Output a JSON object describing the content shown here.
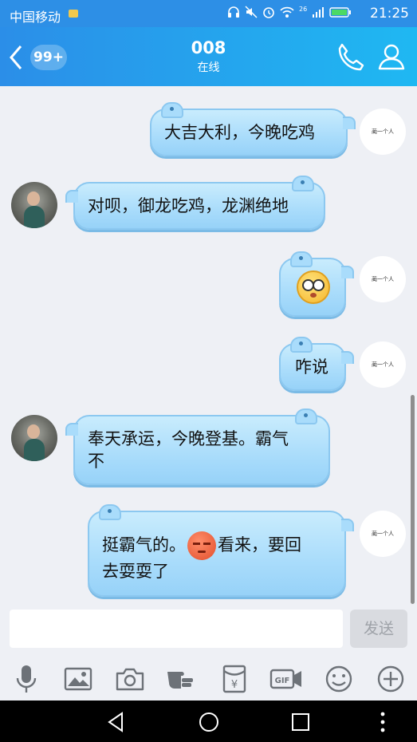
{
  "status_bar": {
    "carrier": "中国移动",
    "time": "21:25",
    "signal_label": "26"
  },
  "header": {
    "unread_count": "99+",
    "title": "008",
    "status": "在线"
  },
  "messages": [
    {
      "sender": "self",
      "text": "大吉大利，今晚吃鸡"
    },
    {
      "sender": "other",
      "text": "对呗，御龙吃鸡，龙渊绝地"
    },
    {
      "sender": "self",
      "emoji": "shocked-face-emoji"
    },
    {
      "sender": "self",
      "text": "咋说"
    },
    {
      "sender": "other",
      "line1": "奉天承运，今晚登基。霸气",
      "line2": "不"
    },
    {
      "sender": "self",
      "part1": "挺霸气的。",
      "part2": "看来，要回",
      "line2": "去耍耍了",
      "emoji": "angry-face-emoji"
    }
  ],
  "self_avatar_signature": "蔺一个人",
  "composer": {
    "input_value": "",
    "send_label": "发送"
  },
  "toolbar": {
    "items": [
      "microphone-icon",
      "image-icon",
      "camera-icon",
      "poke-hand-icon",
      "red-packet-icon",
      "gif-icon",
      "emoji-icon",
      "plus-icon"
    ],
    "gif_label": "GIF",
    "yen_label": "¥"
  },
  "colors": {
    "header_start": "#2b8ee8",
    "header_end": "#1fb8f2",
    "bubble": "#a9dcfb",
    "background": "#eef0f5"
  }
}
